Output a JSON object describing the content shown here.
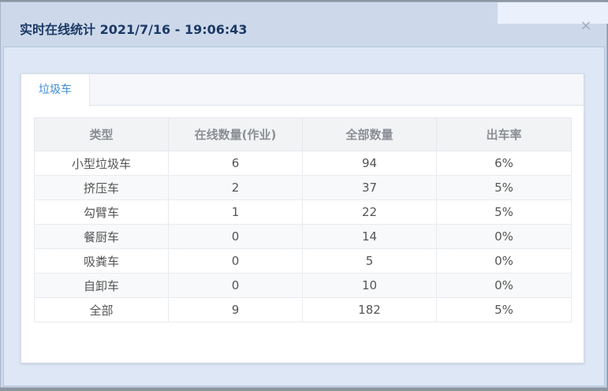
{
  "dialog": {
    "title": "实时在线统计 2021/7/16 - 19:06:43",
    "close_symbol": "×"
  },
  "tabs": [
    {
      "label": "垃圾车",
      "active": true
    }
  ],
  "table": {
    "headers": [
      "类型",
      "在线数量(作业)",
      "全部数量",
      "出车率"
    ],
    "rows": [
      [
        "小型垃圾车",
        "6",
        "94",
        "6%"
      ],
      [
        "挤压车",
        "2",
        "37",
        "5%"
      ],
      [
        "勾臂车",
        "1",
        "22",
        "5%"
      ],
      [
        "餐厨车",
        "0",
        "14",
        "0%"
      ],
      [
        "吸粪车",
        "0",
        "5",
        "0%"
      ],
      [
        "自卸车",
        "0",
        "10",
        "0%"
      ],
      [
        "全部",
        "9",
        "182",
        "5%"
      ]
    ]
  },
  "colors": {
    "title": "#1c3a67",
    "active_tab": "#3d8ad8",
    "header_bg": "#f2f3f5"
  }
}
